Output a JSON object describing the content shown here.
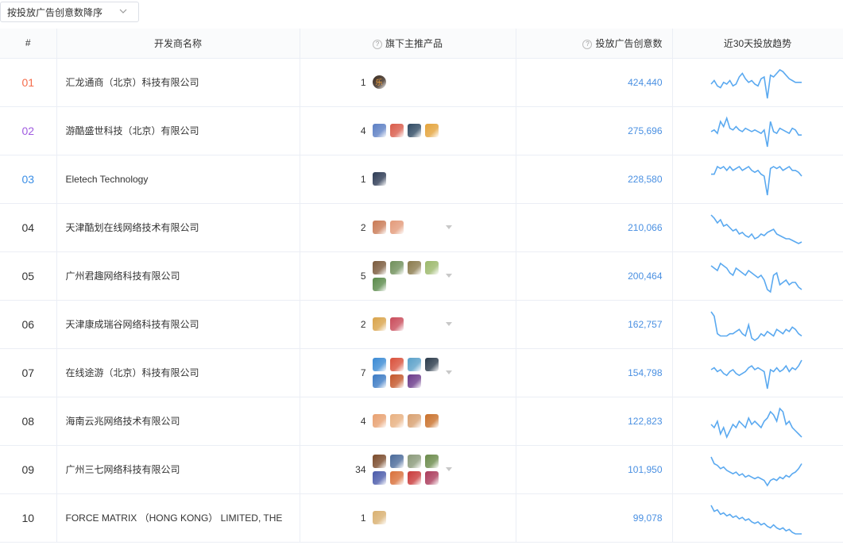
{
  "sort": {
    "label": "按投放广告创意数降序"
  },
  "headers": {
    "rank": "#",
    "name": "开发商名称",
    "products": "旗下主推产品",
    "count": "投放广告创意数",
    "trend": "近30天投放趋势"
  },
  "colors": {
    "rank1": "#f56c4b",
    "rank2": "#a05ce0",
    "rank3": "#3a8ee6",
    "link": "#4a90e2",
    "spark": "#5aa9f0"
  },
  "rows": [
    {
      "rank": "01",
      "name": "汇龙通商（北京）科技有限公司",
      "product_count": "1",
      "icons": [
        "#3a2a1f"
      ],
      "icon_glyph": "乐",
      "creatives": "424,440",
      "trend": [
        12,
        14,
        11,
        10,
        13,
        12,
        14,
        11,
        12,
        16,
        18,
        15,
        13,
        14,
        12,
        11,
        15,
        16,
        4,
        17,
        16,
        18,
        20,
        19,
        17,
        15,
        14,
        13,
        13,
        13
      ]
    },
    {
      "rank": "02",
      "name": "游酷盛世科技（北京）有限公司",
      "product_count": "4",
      "icons": [
        "#5c7fc4",
        "#d95b4a",
        "#2f4a63",
        "#e4a33a"
      ],
      "creatives": "275,696",
      "trend": [
        12,
        13,
        11,
        18,
        15,
        20,
        14,
        13,
        15,
        13,
        12,
        14,
        13,
        12,
        13,
        12,
        11,
        13,
        3,
        18,
        12,
        11,
        14,
        13,
        12,
        11,
        14,
        13,
        10,
        10
      ]
    },
    {
      "rank": "03",
      "name": "Eletech Technology",
      "product_count": "1",
      "icons": [
        "#2c3a54"
      ],
      "creatives": "228,580",
      "trend": [
        14,
        14,
        18,
        17,
        18,
        16,
        18,
        16,
        17,
        18,
        16,
        17,
        18,
        16,
        15,
        16,
        14,
        13,
        3,
        17,
        18,
        17,
        18,
        16,
        17,
        18,
        16,
        16,
        15,
        13
      ]
    },
    {
      "rank": "04",
      "name": "天津酷划在线网络技术有限公司",
      "product_count": "2",
      "icons": [
        "#c97a55",
        "#e39a7a"
      ],
      "caret": true,
      "creatives": "210,066",
      "trend": [
        20,
        18,
        15,
        17,
        13,
        14,
        12,
        10,
        11,
        8,
        9,
        7,
        6,
        8,
        5,
        6,
        8,
        7,
        9,
        10,
        11,
        8,
        7,
        6,
        5,
        5,
        4,
        3,
        2,
        3
      ]
    },
    {
      "rank": "05",
      "name": "广州君趣网络科技有限公司",
      "product_count": "5",
      "icons": [
        "#7a5a3c",
        "#6f8f5a",
        "#8a7a4c",
        "#9bb86a",
        "#5a8a4a"
      ],
      "caret": true,
      "creatives": "200,464",
      "trend": [
        16,
        15,
        14,
        17,
        16,
        15,
        13,
        12,
        15,
        14,
        13,
        12,
        14,
        13,
        12,
        11,
        12,
        10,
        6,
        5,
        12,
        13,
        8,
        9,
        10,
        8,
        9,
        9,
        7,
        6
      ]
    },
    {
      "rank": "06",
      "name": "天津康成瑞谷网络科技有限公司",
      "product_count": "2",
      "icons": [
        "#d9a34a",
        "#c94b5a"
      ],
      "caret": true,
      "creatives": "162,757",
      "trend": [
        20,
        18,
        10,
        9,
        9,
        9,
        10,
        10,
        11,
        12,
        10,
        9,
        14,
        8,
        7,
        8,
        10,
        9,
        11,
        10,
        9,
        12,
        11,
        10,
        12,
        11,
        13,
        12,
        10,
        9
      ]
    },
    {
      "rank": "07",
      "name": "在线途游（北京）科技有限公司",
      "product_count": "7",
      "icons": [
        "#3a8ad4",
        "#d9503a",
        "#5aa0c9",
        "#2a3a4a",
        "#3a7ac4",
        "#c4562a",
        "#6a3a8a"
      ],
      "caret": true,
      "creatives": "154,798",
      "trend": [
        14,
        15,
        13,
        14,
        12,
        11,
        13,
        14,
        12,
        11,
        12,
        13,
        15,
        16,
        14,
        15,
        14,
        13,
        4,
        14,
        13,
        15,
        13,
        14,
        16,
        13,
        15,
        14,
        16,
        19
      ]
    },
    {
      "rank": "08",
      "name": "海南云兆网络技术有限公司",
      "product_count": "4",
      "icons": [
        "#e8a070",
        "#e8b080",
        "#d8a070",
        "#c9702a"
      ],
      "creatives": "122,823",
      "trend": [
        13,
        12,
        14,
        10,
        12,
        9,
        11,
        13,
        12,
        14,
        13,
        12,
        15,
        13,
        14,
        13,
        12,
        14,
        15,
        17,
        16,
        14,
        18,
        17,
        13,
        14,
        12,
        11,
        10,
        9
      ]
    },
    {
      "rank": "09",
      "name": "广州三七网络科技有限公司",
      "product_count": "34",
      "icons": [
        "#7a4a2a",
        "#4a6a9a",
        "#8a9a7a",
        "#6a8a4a",
        "#4a5aaa",
        "#d9703a",
        "#c93a3a",
        "#aa3a5a"
      ],
      "caret": true,
      "creatives": "101,950",
      "trend": [
        20,
        16,
        15,
        13,
        14,
        12,
        11,
        10,
        11,
        9,
        10,
        8,
        9,
        8,
        7,
        8,
        7,
        6,
        3,
        6,
        7,
        6,
        8,
        7,
        9,
        8,
        10,
        11,
        13,
        16
      ]
    },
    {
      "rank": "10",
      "name": "FORCE MATRIX （HONG KONG） LIMITED, THE",
      "product_count": "1",
      "icons": [
        "#d9b070"
      ],
      "creatives": "99,078",
      "trend": [
        20,
        16,
        17,
        14,
        15,
        13,
        14,
        12,
        13,
        11,
        12,
        10,
        11,
        9,
        8,
        9,
        7,
        8,
        6,
        5,
        7,
        5,
        4,
        5,
        3,
        4,
        2,
        1,
        1,
        1
      ]
    }
  ]
}
